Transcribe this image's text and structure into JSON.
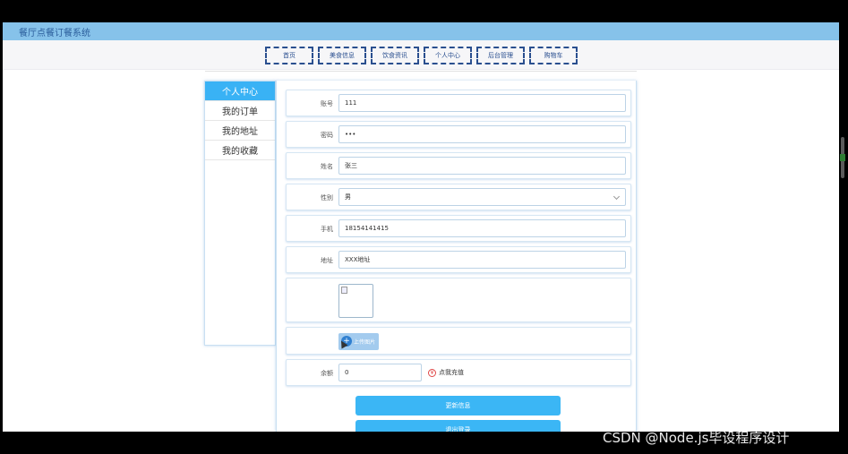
{
  "header": {
    "site_title": "餐厅点餐订餐系统"
  },
  "nav": {
    "items": [
      "首页",
      "美食信息",
      "饮食资讯",
      "个人中心",
      "后台管理",
      "购物车"
    ]
  },
  "sidebar": {
    "items": [
      "个人中心",
      "我的订单",
      "我的地址",
      "我的收藏"
    ],
    "active_index": 0
  },
  "form": {
    "account": {
      "label": "账号",
      "value": "111"
    },
    "password": {
      "label": "密码",
      "value": "•••"
    },
    "name": {
      "label": "姓名",
      "value": "张三"
    },
    "gender": {
      "label": "性别",
      "value": "男"
    },
    "phone": {
      "label": "手机",
      "value": "18154141415"
    },
    "address": {
      "label": "地址",
      "value": "XXX地址"
    },
    "upload_label": "上传图片",
    "balance": {
      "label": "余额",
      "value": "0",
      "recharge_label": "点我充值"
    }
  },
  "buttons": {
    "update": "更新信息",
    "logout": "退出登录"
  },
  "watermark": "CSDN @Node.js毕设程序设计",
  "colors": {
    "topbar": "#86c2ea",
    "accent": "#3bb6f5",
    "nav_border": "#2a4f8f"
  }
}
